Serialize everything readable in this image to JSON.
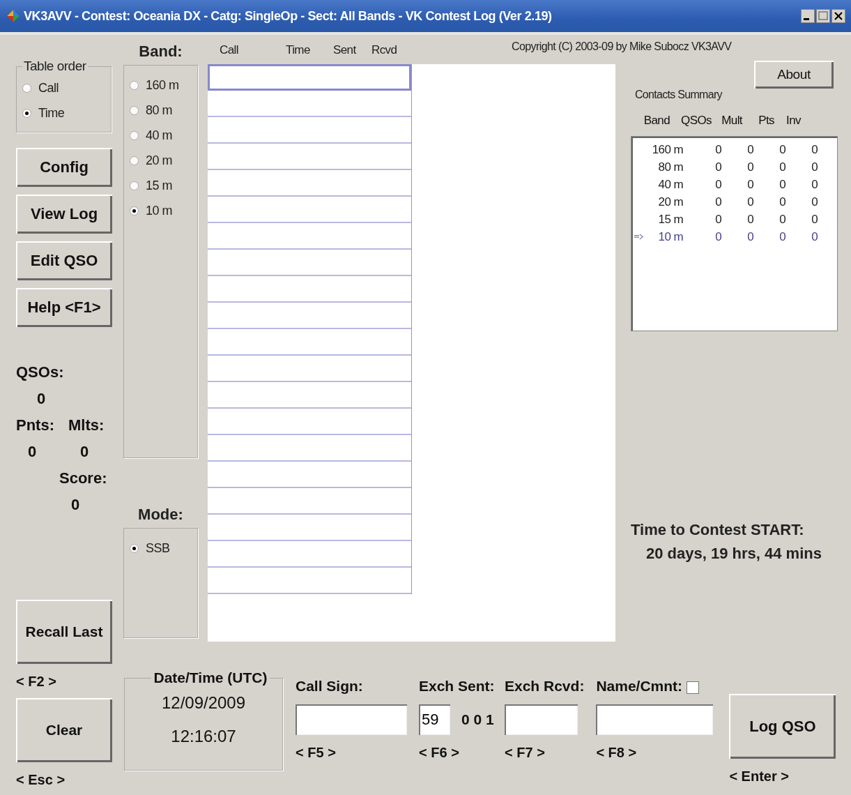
{
  "window": {
    "title": "VK3AVV - Contest: Oceania DX - Catg: SingleOp - Sect: All Bands - VK Contest Log (Ver 2.19)"
  },
  "table_order": {
    "label": "Table order",
    "options": [
      {
        "label": "Call",
        "selected": false
      },
      {
        "label": "Time",
        "selected": true
      }
    ]
  },
  "left_buttons": [
    {
      "label": "Config"
    },
    {
      "label": "View  Log"
    },
    {
      "label": "Edit  QSO"
    },
    {
      "label": "Help <F1>"
    }
  ],
  "stats": {
    "qsos": {
      "label": "QSOs:",
      "value": "0"
    },
    "points": {
      "label": "Pnts:",
      "value": "0"
    },
    "mults": {
      "label": "Mlts:",
      "value": "0"
    },
    "score": {
      "label": "Score:",
      "value": "0"
    }
  },
  "recall_button": {
    "label": "Recall Last",
    "hint": "< F2 >"
  },
  "clear_button": {
    "label": "Clear",
    "hint": "< Esc >"
  },
  "band": {
    "label": "Band:",
    "options": [
      {
        "label": "160 m",
        "selected": false
      },
      {
        "label": "80 m",
        "selected": false
      },
      {
        "label": "40 m",
        "selected": false
      },
      {
        "label": "20 m",
        "selected": false
      },
      {
        "label": "15 m",
        "selected": false
      },
      {
        "label": "10 m",
        "selected": true
      }
    ]
  },
  "mode": {
    "label": "Mode:",
    "options": [
      {
        "label": "SSB",
        "selected": true
      }
    ]
  },
  "log_table": {
    "columns": [
      "Call",
      "Time",
      "Sent",
      "Rcvd"
    ],
    "rows": [
      {
        "selected": true
      },
      {
        "selected": false
      },
      {
        "selected": false
      },
      {
        "selected": false
      },
      {
        "selected": false
      },
      {
        "selected": false
      },
      {
        "selected": false
      },
      {
        "selected": false
      },
      {
        "selected": false
      },
      {
        "selected": false
      },
      {
        "selected": false
      },
      {
        "selected": false
      },
      {
        "selected": false
      },
      {
        "selected": false
      },
      {
        "selected": false
      },
      {
        "selected": false
      },
      {
        "selected": false
      },
      {
        "selected": false
      },
      {
        "selected": false
      },
      {
        "selected": false
      }
    ]
  },
  "copyright": "Copyright (C) 2003-09 by Mike Subocz VK3AVV",
  "about_button": "About",
  "contacts_summary": {
    "title": "Contacts Summary",
    "columns": [
      "Band",
      "QSOs",
      "Mult",
      "Pts",
      "Inv"
    ],
    "rows": [
      {
        "band": "160 m",
        "values": [
          "0",
          "0",
          "0",
          "0"
        ],
        "current": false
      },
      {
        "band": "80 m",
        "values": [
          "0",
          "0",
          "0",
          "0"
        ],
        "current": false
      },
      {
        "band": "40 m",
        "values": [
          "0",
          "0",
          "0",
          "0"
        ],
        "current": false
      },
      {
        "band": "20 m",
        "values": [
          "0",
          "0",
          "0",
          "0"
        ],
        "current": false
      },
      {
        "band": "15 m",
        "values": [
          "0",
          "0",
          "0",
          "0"
        ],
        "current": false
      },
      {
        "band": "10 m",
        "values": [
          "0",
          "0",
          "0",
          "0"
        ],
        "current": true
      }
    ]
  },
  "countdown": {
    "title": "Time to Contest START:",
    "value": "20 days, 19 hrs, 44 mins"
  },
  "datetime": {
    "label": "Date/Time (UTC)",
    "date": "12/09/2009",
    "time": "12:16:07"
  },
  "call_sign": {
    "label": "Call Sign:",
    "hint": "< F5 >"
  },
  "exch_sent": {
    "label": "Exch Sent:",
    "value": "59",
    "serial": "0 0 1",
    "hint": "< F6 >"
  },
  "exch_rcvd": {
    "label": "Exch Rcvd:",
    "hint": "< F7 >"
  },
  "name_comment": {
    "label": "Name/Cmnt:",
    "checked": false,
    "hint": "< F8 >"
  },
  "log_button": {
    "label": "Log QSO",
    "hint": "< Enter >"
  }
}
